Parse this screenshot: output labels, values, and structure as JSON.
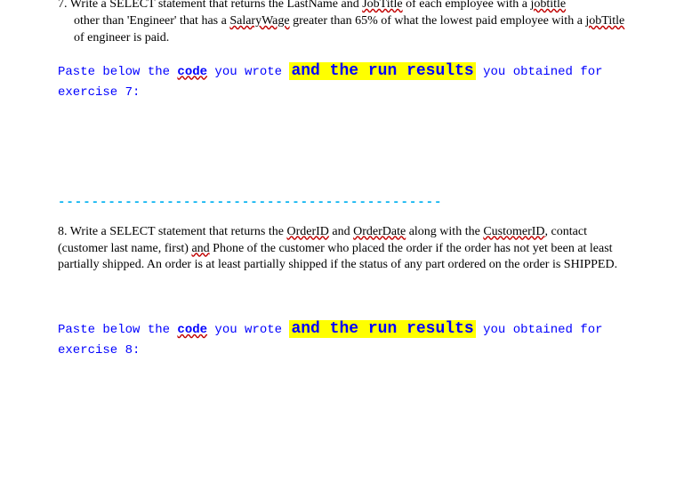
{
  "dividers": {
    "top": "----------------------------------------------",
    "mid": "----------------------------------------------"
  },
  "q7": {
    "number": "7.",
    "text_part1": "Write a SELECT statement that returns the LastName and ",
    "sq1": "JobTitle",
    "text_part2": " of each employee with a ",
    "sq2": "jobtitle",
    "text_part3": "other than 'Engineer' that has a ",
    "sq3": "SalaryWage",
    "text_part4": " greater than 65% of what the lowest paid employee with a ",
    "sq4": "jobTitle",
    "text_part5": " of engineer is paid.",
    "instr_a": "Paste below the ",
    "instr_code": "code",
    "instr_b": " you wrote ",
    "highlight": "and the run results",
    "instr_c": " you obtained for exercise 7:"
  },
  "q8": {
    "number": "8.",
    "text_part1": "Write a SELECT statement that returns the ",
    "sq1": "OrderID",
    "text_mid1": " and ",
    "sq2": "OrderDate",
    "text_mid2": " along with the ",
    "sq3": "CustomerID",
    "text_part2": ", contact (customer last name, first) ",
    "sq4": "and",
    "text_part3": " Phone of the customer who placed the order if the order has not yet been at least partially shipped.  An order is at least partially shipped if the status of any part ordered on the order is SHIPPED.",
    "instr_a": "Paste below the ",
    "instr_code": "code",
    "instr_b": " you wrote ",
    "highlight": "and the run results",
    "instr_c": " you obtained for exercise 8:"
  }
}
